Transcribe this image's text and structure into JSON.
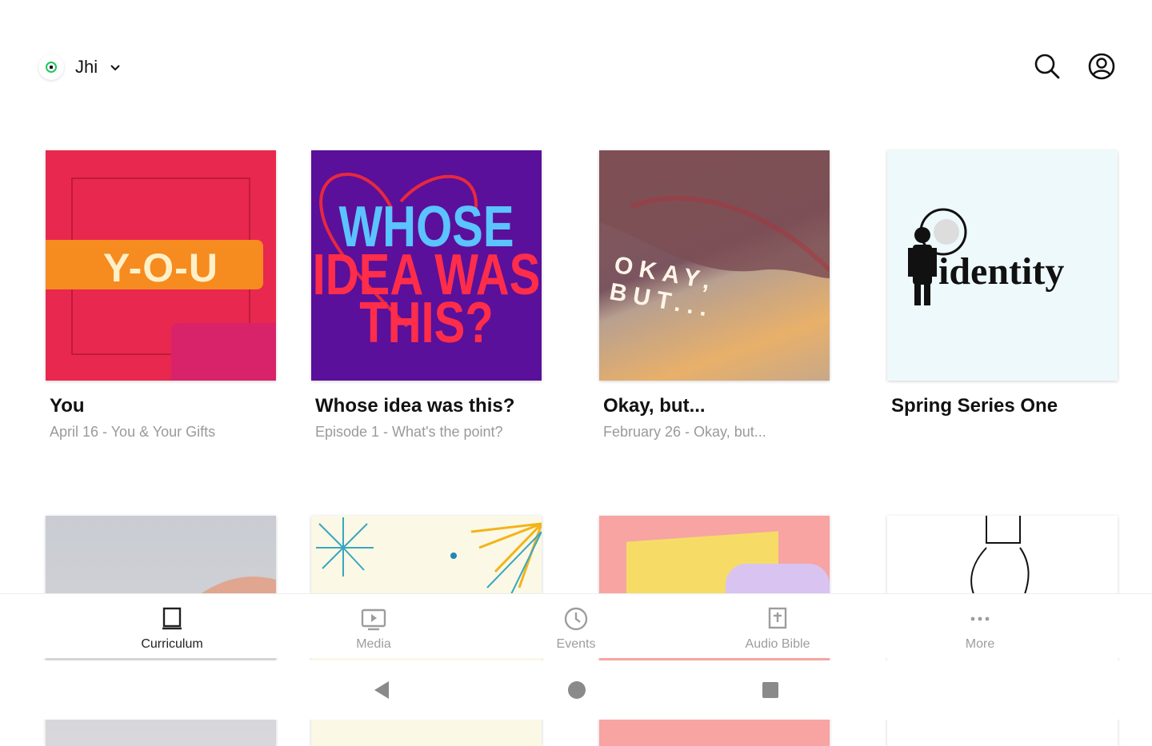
{
  "header": {
    "org_name": "Jhi",
    "org_icon": "church-logo-icon",
    "dropdown_icon": "chevron-down-icon",
    "search_icon": "search-icon",
    "account_icon": "account-icon"
  },
  "series": [
    {
      "title": "You",
      "subtitle": "April 16 - You & Your Gifts",
      "art_text": "Y-O-U"
    },
    {
      "title": "Whose idea was this?",
      "subtitle": "Episode 1 - What's the point?",
      "art_lines": [
        "WHOSE",
        "IDEA WAS",
        "THIS?"
      ]
    },
    {
      "title": "Okay, but...",
      "subtitle": "February 26 - Okay, but...",
      "art_text": "OKAY, BUT..."
    },
    {
      "title": "Spring Series One",
      "subtitle": "",
      "art_text": "identity"
    }
  ],
  "nav": [
    {
      "label": "Curriculum",
      "icon": "book-icon",
      "active": true
    },
    {
      "label": "Media",
      "icon": "video-icon",
      "active": false
    },
    {
      "label": "Events",
      "icon": "clock-icon",
      "active": false
    },
    {
      "label": "Audio Bible",
      "icon": "bible-icon",
      "active": false
    },
    {
      "label": "More",
      "icon": "more-icon",
      "active": false
    }
  ],
  "system_nav": {
    "back": "back-icon",
    "home": "home-icon",
    "recents": "recents-icon"
  },
  "colors": {
    "accent": "#22c55e",
    "text": "#111111",
    "muted": "#9a9a9a"
  }
}
